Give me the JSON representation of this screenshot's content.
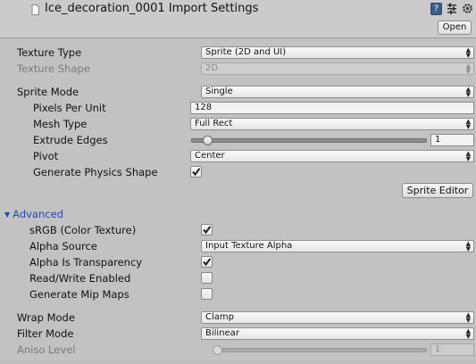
{
  "header": {
    "title": "Ice_decoration_0001 Import Settings",
    "help_icon_glyph": "?",
    "open_button": "Open",
    "icons": [
      "document-icon",
      "help-icon",
      "preset-icon",
      "gear-icon"
    ]
  },
  "texture_type": {
    "label": "Texture Type",
    "value": "Sprite (2D and UI)"
  },
  "texture_shape": {
    "label": "Texture Shape",
    "value": "2D"
  },
  "sprite_mode": {
    "label": "Sprite Mode",
    "value": "Single"
  },
  "pixels_per_unit": {
    "label": "Pixels Per Unit",
    "value": "128"
  },
  "mesh_type": {
    "label": "Mesh Type",
    "value": "Full Rect"
  },
  "extrude_edges": {
    "label": "Extrude Edges",
    "value": "1",
    "slider_fraction": 0.03
  },
  "pivot": {
    "label": "Pivot",
    "value": "Center"
  },
  "generate_physics_shape": {
    "label": "Generate Physics Shape",
    "checked": true
  },
  "sprite_editor_button": "Sprite Editor",
  "advanced": {
    "label": "Advanced",
    "srgb": {
      "label": "sRGB (Color Texture)",
      "checked": true
    },
    "alpha_source": {
      "label": "Alpha Source",
      "value": "Input Texture Alpha"
    },
    "alpha_is_transparency": {
      "label": "Alpha Is Transparency",
      "checked": true
    },
    "read_write_enabled": {
      "label": "Read/Write Enabled",
      "checked": false
    },
    "generate_mip_maps": {
      "label": "Generate Mip Maps",
      "checked": false
    }
  },
  "wrap_mode": {
    "label": "Wrap Mode",
    "value": "Clamp"
  },
  "filter_mode": {
    "label": "Filter Mode",
    "value": "Bilinear"
  },
  "aniso_level": {
    "label": "Aniso Level",
    "value": "1",
    "slider_fraction": 0.0
  },
  "colors": {
    "background": "#c2c2c2",
    "foldout_blue": "#1f4bb8",
    "disabled_text": "#7b7b7b"
  }
}
